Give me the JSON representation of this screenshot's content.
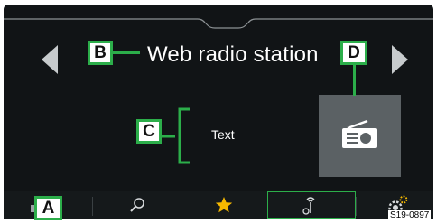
{
  "header": {
    "station_title": "Web radio station"
  },
  "content": {
    "text_label": "Text"
  },
  "callouts": {
    "a": "A",
    "b": "B",
    "c": "C",
    "d": "D"
  },
  "bottom_tabs": [
    {
      "icon": "partial-text-icon",
      "active": false
    },
    {
      "icon": "search-icon",
      "active": false
    },
    {
      "icon": "star-icon",
      "active": false
    },
    {
      "icon": "radio-signal-icon",
      "active": true
    },
    {
      "icon": "settings-gear-icon",
      "active": false
    }
  ],
  "figure_code": "S19-0897",
  "colors": {
    "screen_bg": "#111416",
    "callout_border": "#2cae4a",
    "station_art_bg": "#5b6164",
    "star": "#f5b800",
    "gear_accent": "#f5b800"
  }
}
